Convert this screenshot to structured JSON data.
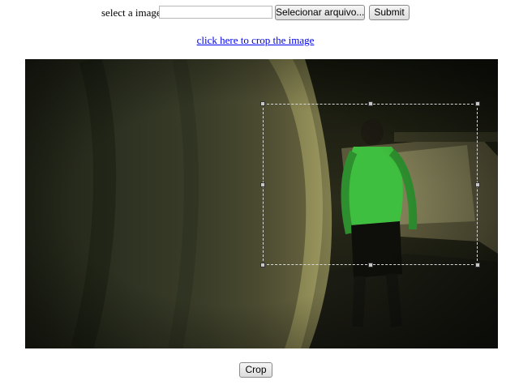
{
  "upload_form": {
    "label": "select a image",
    "file_path_value": "",
    "browse_label": "Selecionar arquivo...",
    "submit_label": "Submit"
  },
  "crop_link": "click here to crop the image",
  "image": {
    "scene": "dark tunnel corridor with a person in a green shirt walking away"
  },
  "crop_button_label": "Crop"
}
